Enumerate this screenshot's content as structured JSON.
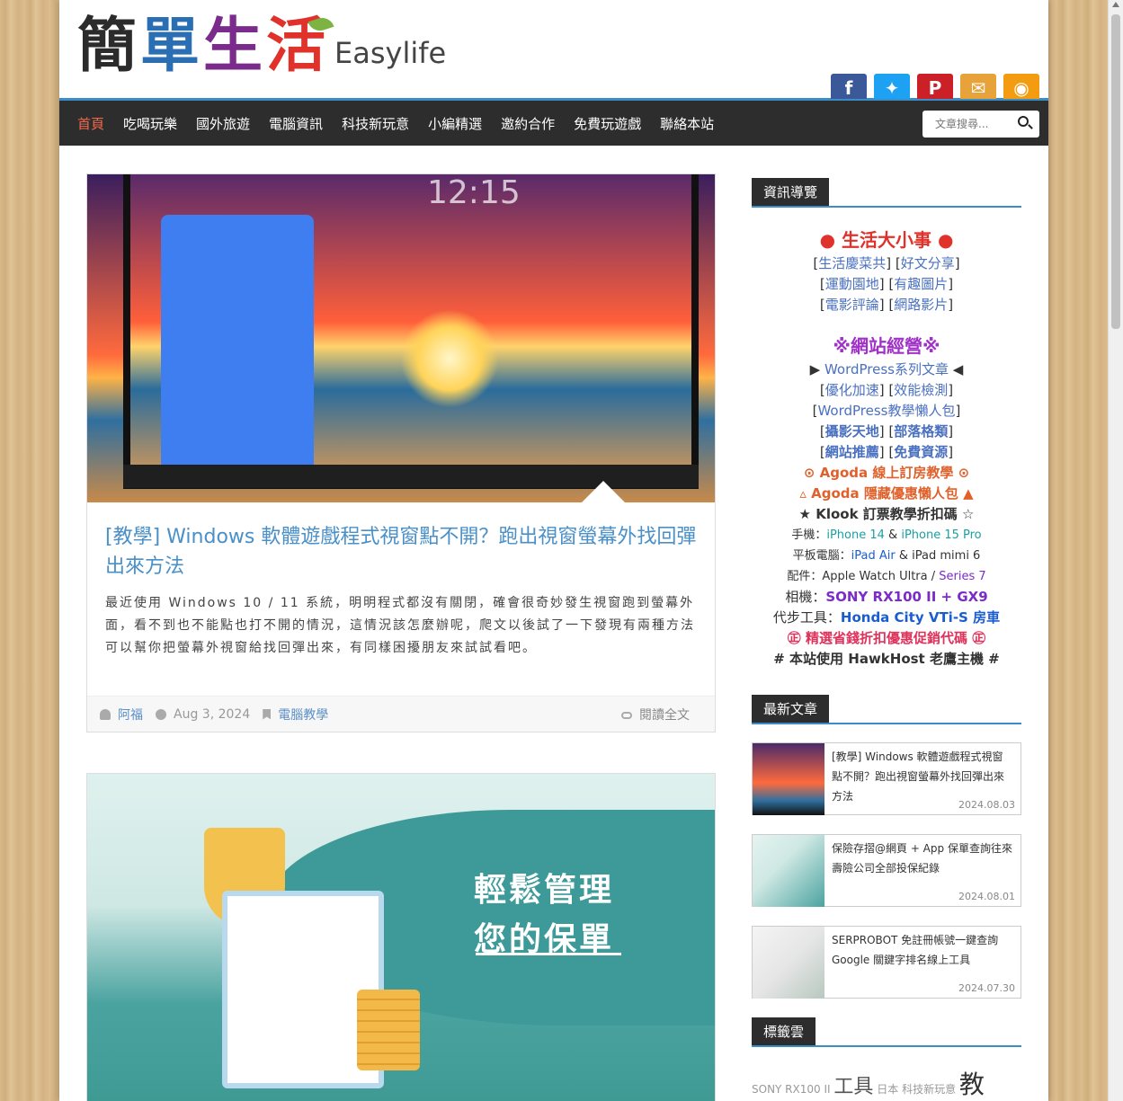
{
  "logo": {
    "chars": [
      "簡",
      "單",
      "生",
      "活"
    ],
    "latin": "Easylife"
  },
  "social": [
    "facebook-icon",
    "twitter-icon",
    "pinterest-icon",
    "mail-icon",
    "rss-icon"
  ],
  "nav": {
    "items": [
      "首頁",
      "吃喝玩樂",
      "國外旅遊",
      "電腦資訊",
      "科技新玩意",
      "小編精選",
      "邀約合作",
      "免費玩遊戲",
      "聯絡本站"
    ],
    "active": "首頁",
    "search_placeholder": "文章搜尋..."
  },
  "posts": [
    {
      "image_time": "12:15",
      "title": "[教學] Windows 軟體遊戲程式視窗點不開？跑出視窗螢幕外找回彈出來方法",
      "excerpt": "最近使用 Windows 10 / 11 系統，明明程式都沒有關閉，確會很奇妙發生視窗跑到螢幕外面，看不到也不能點也打不開的情況，這情況該怎麼辦呢，爬文以後試了一下發現有兩種方法可以幫你把螢幕外視窗給找回彈出來，有同樣困擾朋友來試試看吧。",
      "author": "阿福",
      "date": "Aug 3, 2024",
      "category": "電腦教學",
      "read_more": "閱讀全文"
    },
    {
      "image_text_1": "輕鬆管理",
      "image_text_2": "您的保單"
    }
  ],
  "sidebar": {
    "nav_title": "資訊導覽",
    "life_heading": "● 生活大小事 ●",
    "life_links": [
      [
        "生活慶菜共",
        "好文分享"
      ],
      [
        "運動園地",
        "有趣圖片"
      ],
      [
        "電影評論",
        "網路影片"
      ]
    ],
    "web_heading": "※網站經營※",
    "wp_line": {
      "prefix": "▶ ",
      "link": "WordPress系列文章",
      "suffix": " ◀"
    },
    "web_links": [
      [
        "優化加速",
        "效能檢測"
      ],
      [
        "WordPress教學懶人包"
      ],
      [
        "攝影天地",
        "部落格類"
      ],
      [
        "網站推薦",
        "免費資源"
      ]
    ],
    "agoda1": "⊙ Agoda 線上訂房教學 ⊙",
    "agoda2": "▵ Agoda 隱藏優惠懶人包 ▲",
    "klook": "★ Klook 訂票教學折扣碼 ☆",
    "phone": {
      "label": "手機：",
      "a": "iPhone 14",
      "mid": " & ",
      "b": "iPhone 15 Pro"
    },
    "tablet": {
      "label": "平板電腦：",
      "a": "iPad Air",
      "mid": " & ",
      "b": "iPad mimi 6"
    },
    "accessory": {
      "label": "配件：",
      "a": "Apple Watch Ultra",
      "mid": " / ",
      "b": "Series 7"
    },
    "camera": {
      "label": "相機：",
      "a": "SONY RX100 II + GX9"
    },
    "car": {
      "label": "代步工具：",
      "a": "Honda City VTi-S 房車"
    },
    "promo": "㊣ 精選省錢折扣優惠促銷代碼 ㊣",
    "host": "# 本站使用 HawkHost 老鷹主機 #",
    "recent_title": "最新文章",
    "recent": [
      {
        "title": "[教學] Windows 軟體遊戲程式視窗點不開？跑出視窗螢幕外找回彈出來方法",
        "date": "2024.08.03"
      },
      {
        "title": "保險存摺@網頁 + App 保單查詢往來壽險公司全部投保紀錄",
        "date": "2024.08.01"
      },
      {
        "title": "SERPROBOT 免註冊帳號一鍵查詢 Google 關鍵字排名線上工具",
        "date": "2024.07.30"
      }
    ],
    "tags_title": "標籤雲",
    "tags": [
      "SONY RX100 II",
      "工具",
      "日本",
      "科技新玩意",
      "教"
    ]
  }
}
